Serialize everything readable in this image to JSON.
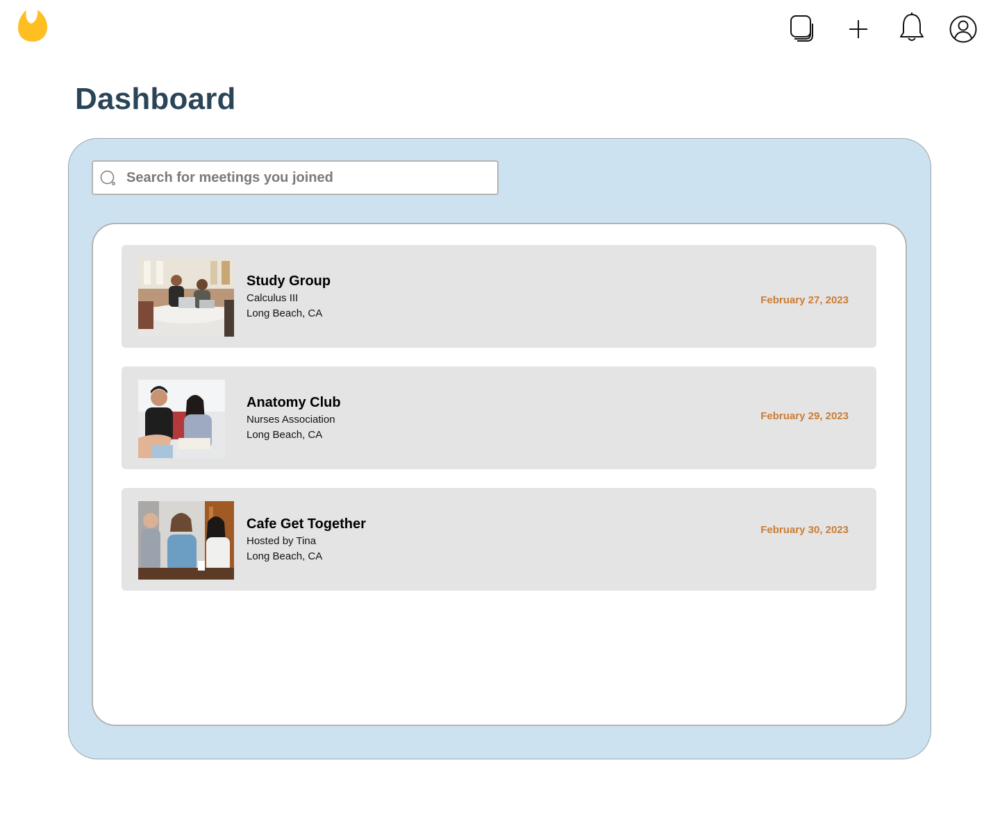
{
  "header": {
    "logo_icon": "flame-icon",
    "logo_color": "#ffbe21",
    "icons": [
      "pages-icon",
      "plus-icon",
      "bell-icon",
      "user-circle-icon"
    ]
  },
  "page": {
    "title": "Dashboard"
  },
  "search": {
    "placeholder": "Search for meetings you joined",
    "value": ""
  },
  "colors": {
    "title": "#2a4557",
    "panel_bg": "#cde2f1",
    "card_bg": "#e4e4e4",
    "date": "#c97d36"
  },
  "meetings": [
    {
      "title": "Study Group",
      "subtitle": "Calculus III",
      "location": "Long Beach, CA",
      "date": "February 27, 2023",
      "image": "study-group-photo"
    },
    {
      "title": "Anatomy Club",
      "subtitle": "Nurses Association",
      "location": "Long Beach, CA",
      "date": "February 29, 2023",
      "image": "anatomy-club-photo"
    },
    {
      "title": "Cafe Get Together",
      "subtitle": "Hosted by Tina",
      "location": "Long Beach, CA",
      "date": "February 30, 2023",
      "image": "cafe-photo"
    }
  ]
}
